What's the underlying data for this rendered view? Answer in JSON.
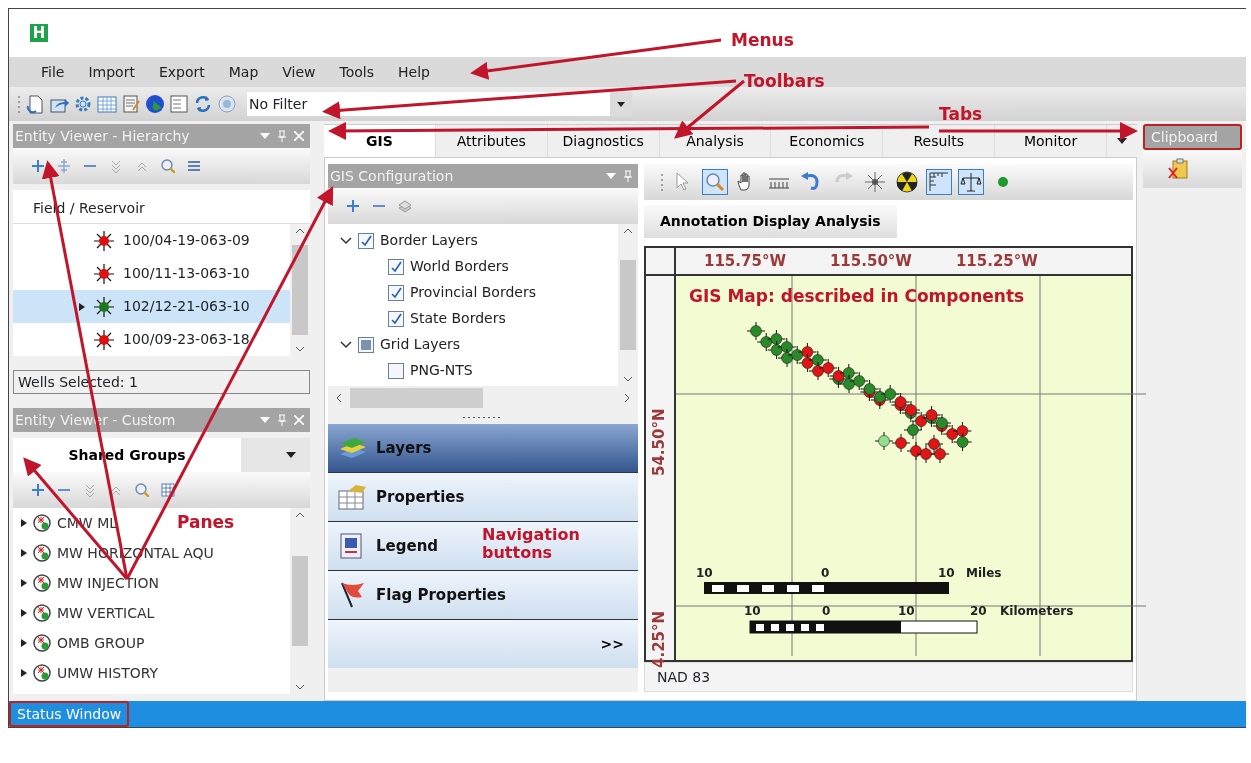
{
  "logo": "H",
  "menus": [
    "File",
    "Import",
    "Export",
    "Map",
    "View",
    "Tools",
    "Help"
  ],
  "toolbar": {
    "filter": "No Filter"
  },
  "hierarchy_pane": {
    "title": "Entity Viewer - Hierarchy",
    "column": "Field / Reservoir",
    "wells": [
      {
        "name": "100/04-19-063-09",
        "color": "#e01010",
        "selected": false
      },
      {
        "name": "100/11-13-063-10",
        "color": "#e01010",
        "selected": false
      },
      {
        "name": "102/12-21-063-10",
        "color": "#1c7a1c",
        "selected": true
      },
      {
        "name": "100/09-23-063-18",
        "color": "#e01010",
        "selected": false
      }
    ],
    "footer": "Wells Selected: 1"
  },
  "custom_pane": {
    "title": "Entity Viewer - Custom",
    "tab": "Shared Groups",
    "groups": [
      "CMW ML",
      "MW HORIZONTAL AQU",
      "MW INJECTION",
      "MW VERTICAL",
      "OMB GROUP",
      "UMW HISTORY"
    ]
  },
  "tabs": [
    {
      "label": "GIS",
      "selected": true
    },
    {
      "label": "Attributes",
      "selected": false
    },
    {
      "label": "Diagnostics",
      "selected": false
    },
    {
      "label": "Analysis",
      "selected": false
    },
    {
      "label": "Economics",
      "selected": false
    },
    {
      "label": "Results",
      "selected": false
    },
    {
      "label": "Monitor",
      "selected": false
    }
  ],
  "gis_config": {
    "title": "GIS Configuration",
    "layers": [
      {
        "label": "Border Layers",
        "checked": true,
        "mixed": false,
        "expanded": true,
        "children": [
          {
            "label": "World Borders",
            "checked": true,
            "mixed": false
          },
          {
            "label": "Provincial Borders",
            "checked": true,
            "mixed": false
          },
          {
            "label": "State Borders",
            "checked": true,
            "mixed": false
          }
        ]
      },
      {
        "label": "Grid Layers",
        "checked": false,
        "mixed": true,
        "expanded": true,
        "children": [
          {
            "label": "PNG-NTS",
            "checked": false,
            "mixed": false
          }
        ]
      }
    ],
    "nav_buttons": [
      {
        "label": "Layers",
        "kind": "layers",
        "selected": true
      },
      {
        "label": "Properties",
        "kind": "properties",
        "selected": false
      },
      {
        "label": "Legend",
        "kind": "legend",
        "selected": false
      },
      {
        "label": "Flag Properties",
        "kind": "flag",
        "selected": false
      }
    ],
    "more": ">>"
  },
  "map_tools": [
    {
      "kind": "pointer",
      "selected": false
    },
    {
      "kind": "zoom",
      "selected": true
    },
    {
      "kind": "pan",
      "selected": false
    },
    {
      "kind": "ruler",
      "selected": false
    },
    {
      "kind": "undo",
      "selected": false
    },
    {
      "kind": "redo",
      "selected": false
    },
    {
      "kind": "burst",
      "selected": false
    },
    {
      "kind": "radiation",
      "selected": false
    },
    {
      "kind": "scale",
      "selected": true
    },
    {
      "kind": "balance",
      "selected": true
    },
    {
      "kind": "dot",
      "selected": false
    }
  ],
  "map": {
    "tab": "Annotation Display Analysis",
    "longitudes": [
      "115.75°W",
      "115.50°W",
      "115.25°W"
    ],
    "latitudes": [
      "54.50°N",
      "4.25°N"
    ],
    "miles_scale": {
      "ticks": [
        "10",
        "0",
        "10"
      ],
      "unit": "Miles"
    },
    "km_scale": {
      "ticks": [
        "10",
        "0",
        "10",
        "20"
      ],
      "unit": "Kilometers"
    },
    "datum": "NAD 83"
  },
  "clipboard": {
    "title": "Clipboard"
  },
  "status_window": {
    "title": "Status Window"
  },
  "annotations": [
    {
      "kind": "menus",
      "text": "Menus"
    },
    {
      "kind": "toolbars",
      "text": "Toolbars"
    },
    {
      "kind": "tabs",
      "text": "Tabs"
    },
    {
      "kind": "panes",
      "text": "Panes"
    },
    {
      "kind": "navigation",
      "text": "Navigation buttons"
    },
    {
      "kind": "map",
      "text": "GIS Map: described in Components"
    }
  ]
}
